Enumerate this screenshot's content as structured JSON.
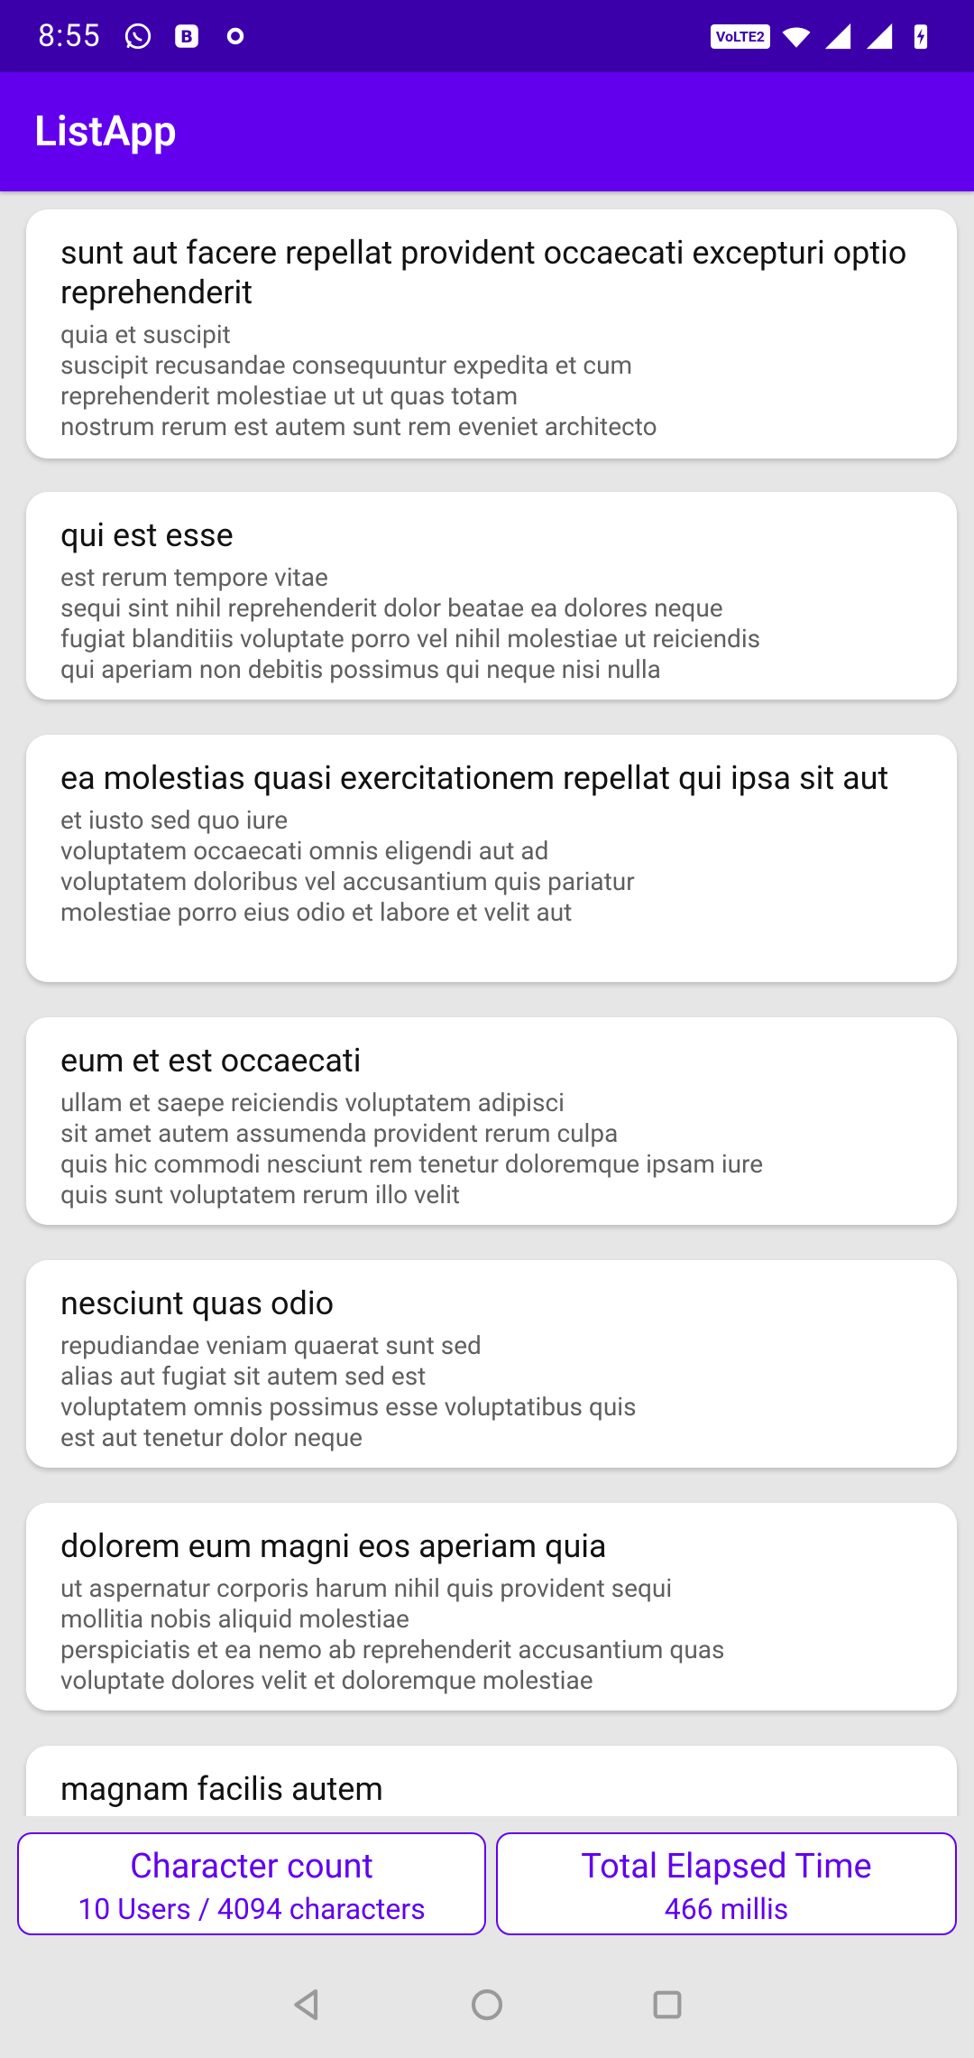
{
  "status_bar": {
    "time": "8:55",
    "volte": "VoLTE2"
  },
  "app_bar": {
    "title": "ListApp"
  },
  "posts": [
    {
      "title": "sunt aut facere repellat provident occaecati excepturi optio reprehenderit",
      "body": "quia et suscipit\nsuscipit recusandae consequuntur expedita et cum\nreprehenderit molestiae ut ut quas totam\nnostrum rerum est autem sunt rem eveniet architecto"
    },
    {
      "title": "qui est esse",
      "body": "est rerum tempore vitae\nsequi sint nihil reprehenderit dolor beatae ea dolores neque\nfugiat blanditiis voluptate porro vel nihil molestiae ut reiciendis\nqui aperiam non debitis possimus qui neque nisi nulla"
    },
    {
      "title": "ea molestias quasi exercitationem repellat qui ipsa sit aut",
      "body": "et iusto sed quo iure\nvoluptatem occaecati omnis eligendi aut ad\nvoluptatem doloribus vel accusantium quis pariatur\nmolestiae porro eius odio et labore et velit aut"
    },
    {
      "title": "eum et est occaecati",
      "body": "ullam et saepe reiciendis voluptatem adipisci\nsit amet autem assumenda provident rerum culpa\nquis hic commodi nesciunt rem tenetur doloremque ipsam iure\nquis sunt voluptatem rerum illo velit"
    },
    {
      "title": "nesciunt quas odio",
      "body": "repudiandae veniam quaerat sunt sed\nalias aut fugiat sit autem sed est\nvoluptatem omnis possimus esse voluptatibus quis\nest aut tenetur dolor neque"
    },
    {
      "title": "dolorem eum magni eos aperiam quia",
      "body": "ut aspernatur corporis harum nihil quis provident sequi\nmollitia nobis aliquid molestiae\nperspiciatis et ea nemo ab reprehenderit accusantium quas\nvoluptate dolores velit et doloremque molestiae"
    },
    {
      "title": "magnam facilis autem",
      "body": ""
    }
  ],
  "stats": {
    "character_count": {
      "title": "Character count",
      "value": "10 Users  / 4094 characters"
    },
    "elapsed_time": {
      "title": "Total Elapsed Time",
      "value": "466 millis"
    }
  },
  "colors": {
    "status_bar": "#3c00ab",
    "app_bar": "#6200ee",
    "accent": "#6200ee",
    "background": "#e6e6e6"
  }
}
